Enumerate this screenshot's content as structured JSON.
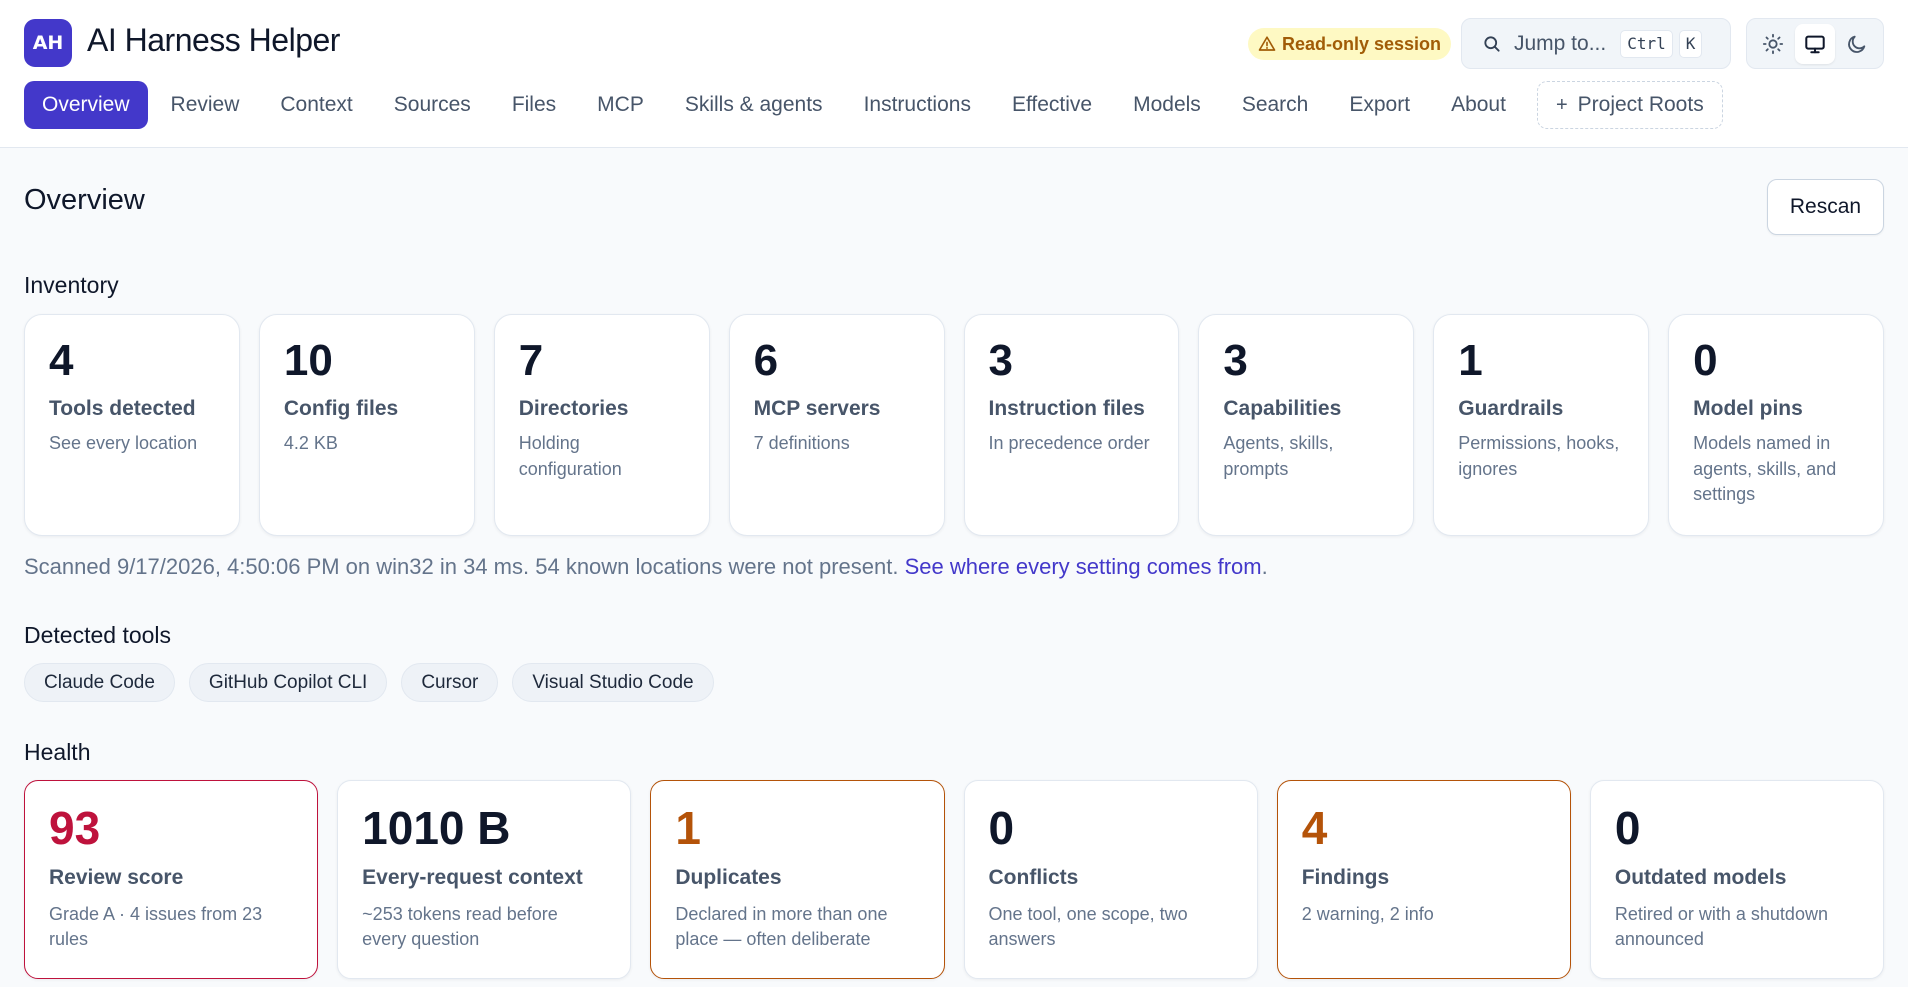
{
  "app": {
    "logo": "AH",
    "title": "AI Harness Helper",
    "readonly_badge": "Read-only session",
    "jump": {
      "label": "Jump to...",
      "key1": "Ctrl",
      "key2": "K"
    },
    "theme_icons": [
      "sun-icon",
      "monitor-icon",
      "moon-icon"
    ],
    "accent_color": "#4338ca"
  },
  "nav": {
    "tabs": [
      "Overview",
      "Review",
      "Context",
      "Sources",
      "Files",
      "MCP",
      "Skills & agents",
      "Instructions",
      "Effective",
      "Models",
      "Search",
      "Export",
      "About"
    ],
    "active": "Overview",
    "roots_label": "Project Roots"
  },
  "page": {
    "title": "Overview",
    "rescan_label": "Rescan"
  },
  "inventory": {
    "title": "Inventory",
    "cards": [
      {
        "value": "4",
        "label": "Tools detected",
        "desc": "See every location"
      },
      {
        "value": "10",
        "label": "Config files",
        "desc": "4.2 KB"
      },
      {
        "value": "7",
        "label": "Directories",
        "desc": "Holding configuration"
      },
      {
        "value": "6",
        "label": "MCP servers",
        "desc": "7 definitions"
      },
      {
        "value": "3",
        "label": "Instruction files",
        "desc": "In precedence order"
      },
      {
        "value": "3",
        "label": "Capabilities",
        "desc": "Agents, skills, prompts"
      },
      {
        "value": "1",
        "label": "Guardrails",
        "desc": "Permissions, hooks, ignores"
      },
      {
        "value": "0",
        "label": "Model pins",
        "desc": "Models named in agents, skills, and settings"
      }
    ]
  },
  "scan": {
    "text": "Scanned 9/17/2026, 4:50:06 PM on win32 in 34 ms. 54 known locations were not present. ",
    "link": "See where every setting comes from",
    "suffix": "."
  },
  "tools": {
    "title": "Detected tools",
    "chips": [
      "Claude Code",
      "GitHub Copilot CLI",
      "Cursor",
      "Visual Studio Code"
    ]
  },
  "health": {
    "title": "Health",
    "cards": [
      {
        "value": "93",
        "label": "Review score",
        "desc": "Grade A · 4 issues from 23 rules",
        "status": "red"
      },
      {
        "value": "1010 B",
        "label": "Every-request context",
        "desc": "~253 tokens read before every question",
        "status": "normal"
      },
      {
        "value": "1",
        "label": "Duplicates",
        "desc": "Declared in more than one place — often deliberate",
        "status": "orange"
      },
      {
        "value": "0",
        "label": "Conflicts",
        "desc": "One tool, one scope, two answers",
        "status": "normal"
      },
      {
        "value": "4",
        "label": "Findings",
        "desc": "2 warning, 2 info",
        "status": "orange"
      },
      {
        "value": "0",
        "label": "Outdated models",
        "desc": "Retired or with a shutdown announced",
        "status": "normal"
      }
    ],
    "colors": {
      "red": "#be123c",
      "orange": "#b45309"
    }
  }
}
